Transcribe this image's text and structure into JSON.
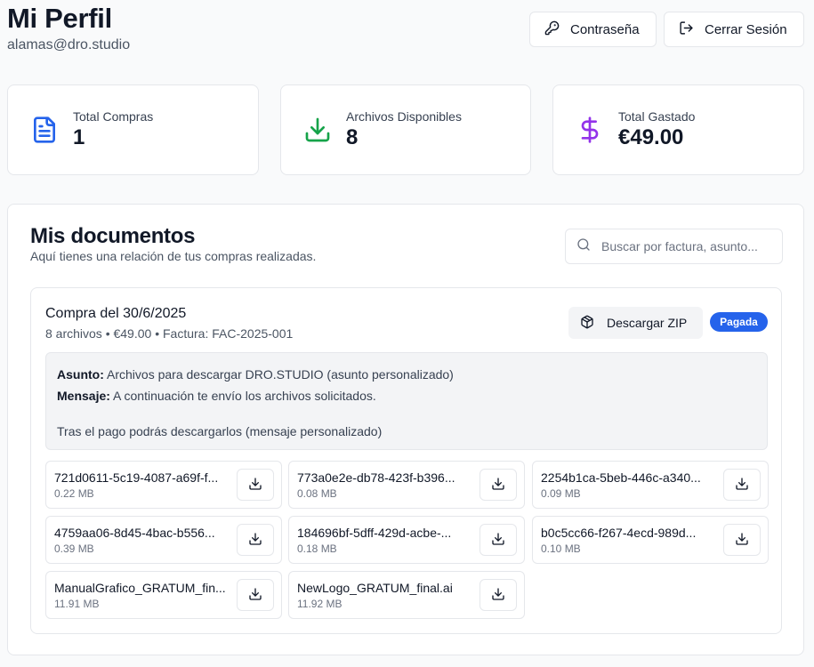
{
  "header": {
    "title": "Mi Perfil",
    "email": "alamas@dro.studio",
    "password_button": "Contraseña",
    "logout_button": "Cerrar Sesión"
  },
  "stats": [
    {
      "label": "Total Compras",
      "value": "1",
      "icon": "file-text-icon",
      "color": "#2563eb"
    },
    {
      "label": "Archivos Disponibles",
      "value": "8",
      "icon": "download-icon",
      "color": "#16a34a"
    },
    {
      "label": "Total Gastado",
      "value": "€49.00",
      "icon": "dollar-icon",
      "color": "#9333ea"
    }
  ],
  "documents": {
    "title": "Mis documentos",
    "subtitle": "Aquí tienes una relación de tus compras realizadas.",
    "search_placeholder": "Buscar por factura, asunto..."
  },
  "purchase": {
    "title": "Compra del 30/6/2025",
    "meta": "8 archivos • €49.00 • Factura: FAC-2025-001",
    "zip_button": "Descargar ZIP",
    "status": "Pagada",
    "subject_label": "Asunto:",
    "subject": "Archivos para descargar DRO.STUDIO (asunto personalizado)",
    "message_label": "Mensaje:",
    "message_line1": "A continuación te envío los archivos solicitados.",
    "message_line2": "Tras el pago podrás descargarlos (mensaje personalizado)"
  },
  "files": [
    {
      "name": "721d0611-5c19-4087-a69f-f...",
      "size": "0.22 MB"
    },
    {
      "name": "773a0e2e-db78-423f-b396...",
      "size": "0.08 MB"
    },
    {
      "name": "2254b1ca-5beb-446c-a340...",
      "size": "0.09 MB"
    },
    {
      "name": "4759aa06-8d45-4bac-b556...",
      "size": "0.39 MB"
    },
    {
      "name": "184696bf-5dff-429d-acbe-...",
      "size": "0.18 MB"
    },
    {
      "name": "b0c5cc66-f267-4ecd-989d...",
      "size": "0.10 MB"
    },
    {
      "name": "ManualGrafico_GRATUM_fin...",
      "size": "11.91 MB"
    },
    {
      "name": "NewLogo_GRATUM_final.ai",
      "size": "11.92 MB"
    }
  ],
  "colors": {
    "accent": "#2563eb",
    "success": "#16a34a",
    "purple": "#9333ea"
  }
}
